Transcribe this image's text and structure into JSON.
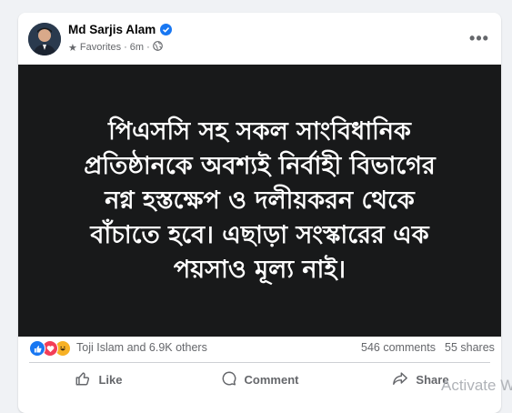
{
  "post": {
    "author": "Md Sarjis Alam",
    "audience": "Favorites",
    "time": "6m",
    "text": "পিএসসি সহ সকল সাংবিধানিক\nপ্রতিষ্ঠানকে অবশ্যই নির্বাহী বিভাগের\nনগ্ন হস্তক্ষেপ ও দলীয়করন থেকে\nবাঁচাতে হবে। এছাড়া সংস্কারের এক\nপয়সাও মূল্য নাই।",
    "more_label": "•••"
  },
  "stats": {
    "reactors": "Toji Islam and 6.9K others",
    "comments": "546 comments",
    "shares": "55 shares"
  },
  "actions": {
    "like": "Like",
    "comment": "Comment",
    "share": "Share"
  },
  "watermark": "Activate W",
  "colors": {
    "brand_blue": "#1877f2",
    "post_background": "#18191a",
    "muted_text": "#65676b"
  }
}
